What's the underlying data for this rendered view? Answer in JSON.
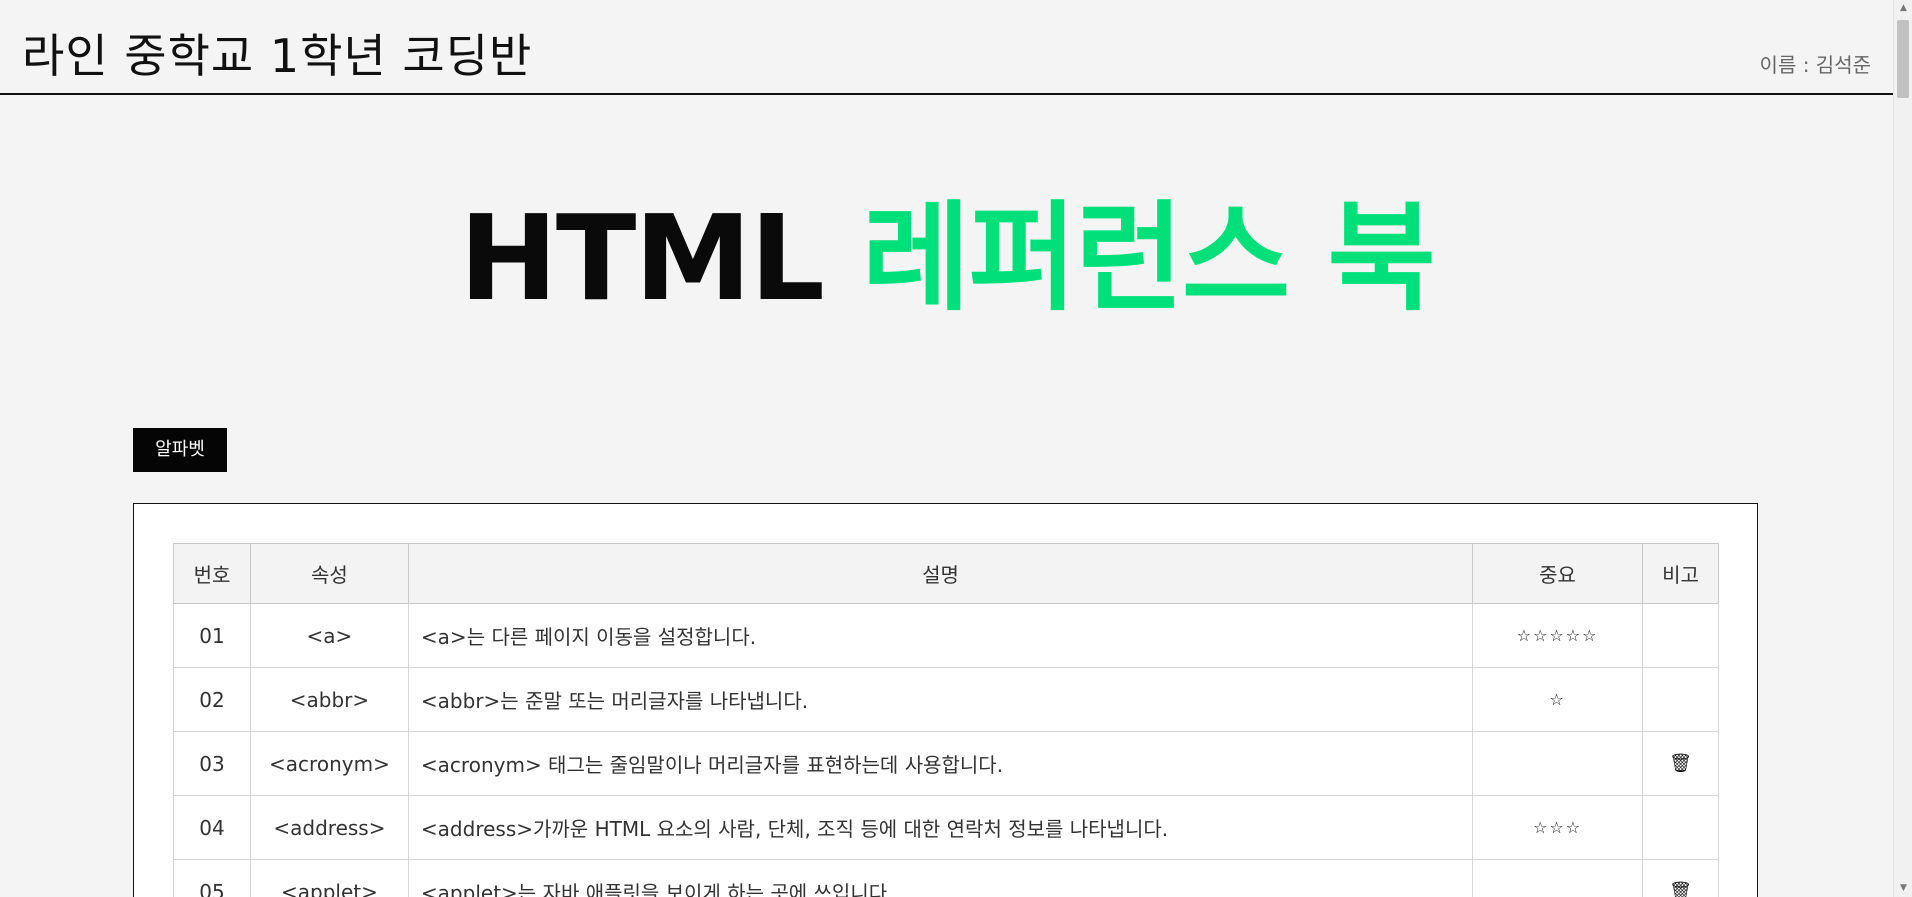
{
  "header": {
    "title": "라인 중학교 1학년 코딩반",
    "user": "이름 : 김석준"
  },
  "hero": {
    "part1": "HTML",
    "part2": "레퍼런스 북"
  },
  "filter_button": "알파벳",
  "table": {
    "headers": [
      "번호",
      "속성",
      "설명",
      "중요",
      "비고"
    ],
    "rows": [
      {
        "no": "01",
        "tag": "<a>",
        "desc": "<a>는 다른 페이지 이동을 설정합니다.",
        "stars": "☆☆☆☆☆",
        "note": ""
      },
      {
        "no": "02",
        "tag": "<abbr>",
        "desc": "<abbr>는 준말 또는 머리글자를 나타냅니다.",
        "stars": "☆",
        "note": ""
      },
      {
        "no": "03",
        "tag": "<acronym>",
        "desc": "<acronym> 태그는 줄임말이나 머리글자를 표현하는데 사용합니다.",
        "stars": "",
        "note": "🗑"
      },
      {
        "no": "04",
        "tag": "<address>",
        "desc": "<address>가까운 HTML 요소의 사람, 단체, 조직 등에 대한 연락처 정보를 나타냅니다.",
        "stars": "☆☆☆",
        "note": ""
      },
      {
        "no": "05",
        "tag": "<applet>",
        "desc": "<applet>는 자바 애플릿을 보이게 하는 곳에 쓰입니다.",
        "stars": "",
        "note": "🗑"
      }
    ]
  },
  "colors": {
    "accent_green": "#00e07a",
    "background": "#f4f4f4",
    "button_bg": "#050505"
  },
  "icons": {
    "trash": "trash-icon",
    "star": "star-icon"
  }
}
